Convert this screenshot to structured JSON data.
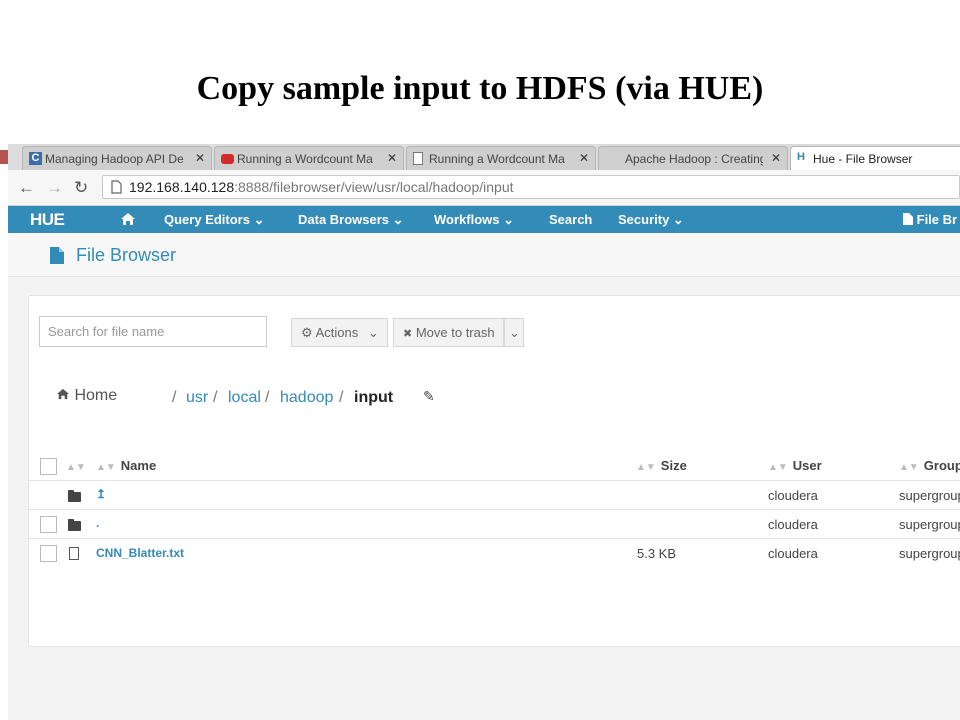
{
  "slide": {
    "title": "Copy sample input to HDFS (via HUE)"
  },
  "tabs": [
    {
      "label": "Managing Hadoop API De",
      "icon": "cloudera-c-icon"
    },
    {
      "label": "Running a Wordcount Ma",
      "icon": "youtube-icon"
    },
    {
      "label": "Running a Wordcount Ma",
      "icon": "page-icon"
    },
    {
      "label": "Apache Hadoop : Creating",
      "icon": "none"
    },
    {
      "label": "Hue - File Browser",
      "icon": "hue-icon"
    }
  ],
  "address": {
    "host": "192.168.140.128",
    "path": ":8888/filebrowser/view/usr/local/hadoop/input"
  },
  "nav": {
    "logo": "HUE",
    "items": [
      "Query Editors",
      "Data Browsers",
      "Workflows",
      "Search",
      "Security"
    ],
    "right": "File Br"
  },
  "page": {
    "title": "File Browser"
  },
  "toolbar": {
    "search_placeholder": "Search for file name",
    "actions": "Actions",
    "move_to_trash": "Move to trash"
  },
  "breadcrumb": {
    "home": "Home",
    "parts": [
      "usr",
      "local",
      "hadoop"
    ],
    "current": "input",
    "sep": "/"
  },
  "table": {
    "columns": [
      "Name",
      "Size",
      "User",
      "Group"
    ],
    "rows": [
      {
        "name": "↥",
        "size": "",
        "user": "cloudera",
        "group": "supergroup",
        "type": "folder"
      },
      {
        "name": ".",
        "size": "",
        "user": "cloudera",
        "group": "supergroup",
        "type": "folder"
      },
      {
        "name": "CNN_Blatter.txt",
        "size": "5.3 KB",
        "user": "cloudera",
        "group": "supergroup",
        "type": "file"
      }
    ]
  },
  "colors": {
    "hue_blue": "#338bb8",
    "link": "#338bb8"
  }
}
